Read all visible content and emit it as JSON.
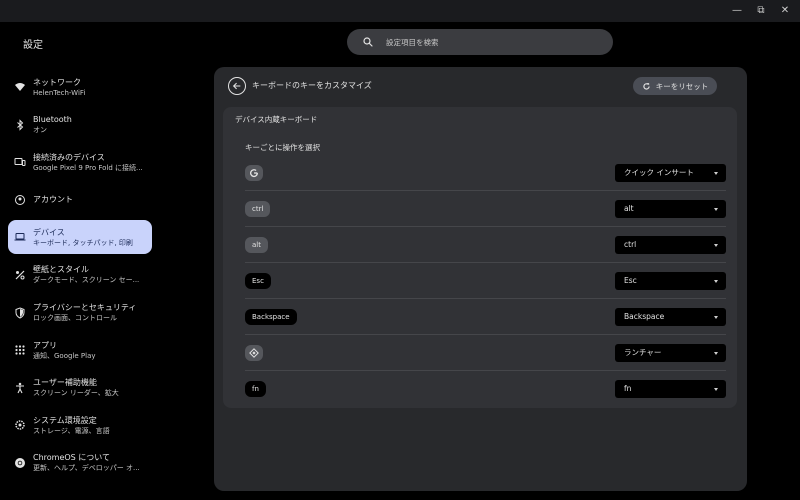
{
  "window": {
    "minimize": "—",
    "maximize": "⧉",
    "close": "✕"
  },
  "app": {
    "title": "設定"
  },
  "search": {
    "placeholder": "設定項目を検索"
  },
  "sidebar": {
    "items": [
      {
        "title": "ネットワーク",
        "sub": "HelenTech-WiFi",
        "icon": "wifi-icon"
      },
      {
        "title": "Bluetooth",
        "sub": "オン",
        "icon": "bluetooth-icon"
      },
      {
        "title": "接続済みのデバイス",
        "sub": "Google Pixel 9 Pro Fold に接続...",
        "icon": "connected-devices-icon"
      },
      {
        "title": "アカウント",
        "sub": "",
        "icon": "account-icon"
      },
      {
        "title": "デバイス",
        "sub": "キーボード, タッチパッド, 印刷",
        "icon": "laptop-icon"
      },
      {
        "title": "壁紙とスタイル",
        "sub": "ダークモード、スクリーン セー...",
        "icon": "palette-icon"
      },
      {
        "title": "プライバシーとセキュリティ",
        "sub": "ロック画面、コントロール",
        "icon": "shield-icon"
      },
      {
        "title": "アプリ",
        "sub": "通知、Google Play",
        "icon": "apps-grid-icon"
      },
      {
        "title": "ユーザー補助機能",
        "sub": "スクリーン リーダー、拡大",
        "icon": "accessibility-icon"
      },
      {
        "title": "システム環境設定",
        "sub": "ストレージ、電源、言語",
        "icon": "system-gear-icon"
      },
      {
        "title": "ChromeOS について",
        "sub": "更新、ヘルプ、デベロッパー オ...",
        "icon": "chromeos-icon"
      }
    ],
    "active_index": 4
  },
  "panel": {
    "title": "キーボードのキーをカスタマイズ",
    "reset_label": "キーをリセット",
    "card_title": "デバイス内蔵キーボード",
    "card_subtitle": "キーごとに操作を選択",
    "rows": [
      {
        "key": "",
        "key_icon": "google-g-icon",
        "action": "クイック インサート"
      },
      {
        "key": "ctrl",
        "action": "alt"
      },
      {
        "key": "alt",
        "action": "ctrl"
      },
      {
        "key": "Esc",
        "action": "Esc"
      },
      {
        "key": "Backspace",
        "action": "Backspace"
      },
      {
        "key": "",
        "key_icon": "launcher-icon",
        "action": "ランチャー"
      },
      {
        "key": "fn",
        "action": "fn"
      }
    ]
  },
  "colors": {
    "background": "#000000",
    "panel": "#28292c",
    "card": "#313236",
    "active_nav": "#c9d3fb",
    "reset_button": "#4a4d55"
  }
}
